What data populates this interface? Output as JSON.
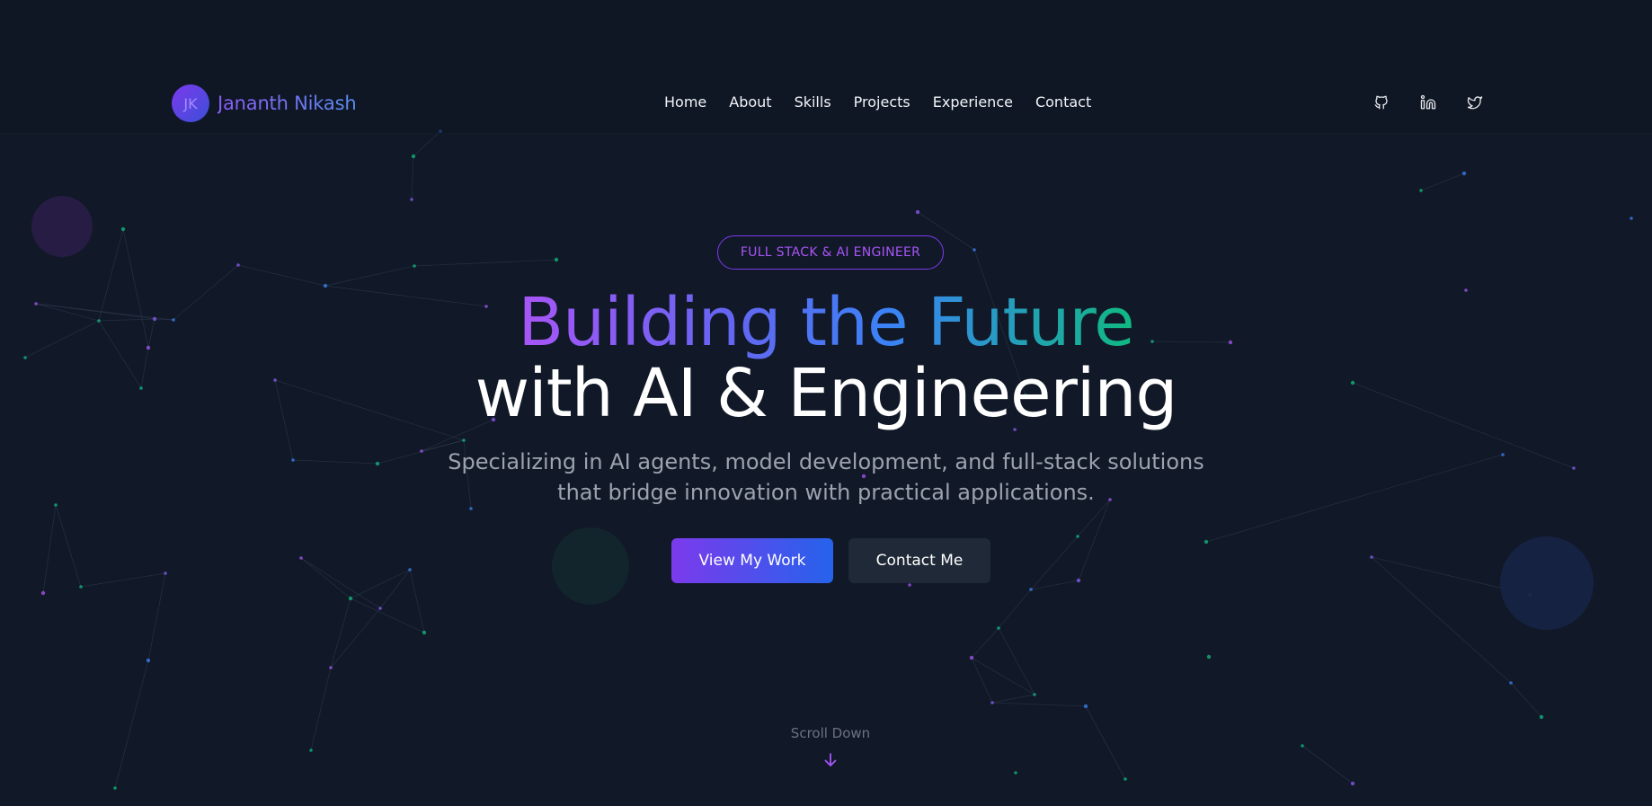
{
  "brand": {
    "initials": "JK",
    "name": "Jananth Nikash"
  },
  "nav": {
    "items": [
      "Home",
      "About",
      "Skills",
      "Projects",
      "Experience",
      "Contact"
    ]
  },
  "socials": {
    "icons": [
      "github-icon",
      "linkedin-icon",
      "twitter-icon"
    ]
  },
  "hero": {
    "badge": "FULL STACK & AI ENGINEER",
    "headline_line1": "Building the Future",
    "headline_line2": "with AI & Engineering",
    "subtitle_line1": "Specializing in AI agents, model development, and full-stack solutions",
    "subtitle_line2": "that bridge innovation with practical applications.",
    "primary_button": "View My Work",
    "secondary_button": "Contact Me",
    "scroll_label": "Scroll Down"
  },
  "colors": {
    "background": "#111827",
    "accent_purple": "#7c3aed",
    "accent_blue": "#2563eb",
    "accent_green": "#10b981",
    "muted_text": "#9ca3af"
  }
}
